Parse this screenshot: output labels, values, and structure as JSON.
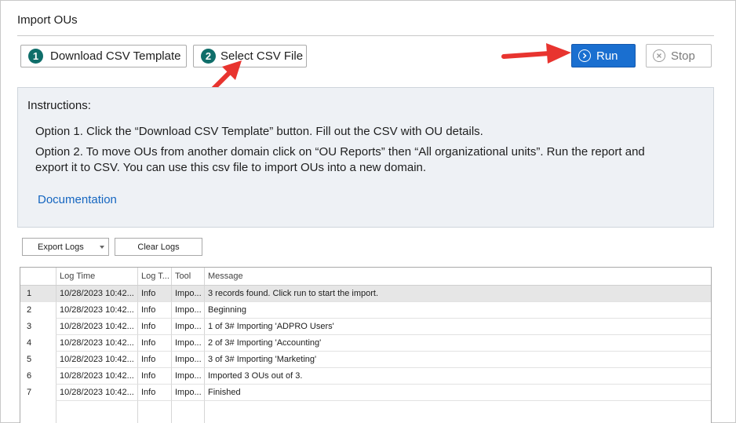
{
  "window": {
    "title": "Import OUs"
  },
  "toolbar": {
    "download": {
      "step": "1",
      "label": "Download CSV Template"
    },
    "select": {
      "step": "2",
      "label": "Select CSV File"
    },
    "run_label": "Run",
    "stop_label": "Stop"
  },
  "instructions": {
    "heading": "Instructions:",
    "option1": "Option 1. Click the “Download CSV Template” button. Fill out the CSV with OU details.",
    "option2_line1": "Option 2. To move OUs from another domain click on “OU Reports” then “All organizational units”. Run the report and",
    "option2_line2": "export it to CSV. You can use this csv file to import OUs into a new domain.",
    "link": "Documentation"
  },
  "log_actions": {
    "export_label": "Export Logs",
    "clear_label": "Clear Logs"
  },
  "log_grid": {
    "columns": [
      "Log Time",
      "Log T...",
      "Tool",
      "Message"
    ],
    "rows": [
      {
        "n": "1",
        "time": "10/28/2023 10:42...",
        "type": "Info",
        "tool": "Impo...",
        "message": "3 records found. Click run to start the import."
      },
      {
        "n": "2",
        "time": "10/28/2023 10:42...",
        "type": "Info",
        "tool": "Impo...",
        "message": "Beginning"
      },
      {
        "n": "3",
        "time": "10/28/2023 10:42...",
        "type": "Info",
        "tool": "Impo...",
        "message": "1 of 3# Importing 'ADPRO Users'"
      },
      {
        "n": "4",
        "time": "10/28/2023 10:42...",
        "type": "Info",
        "tool": "Impo...",
        "message": "2 of 3# Importing 'Accounting'"
      },
      {
        "n": "5",
        "time": "10/28/2023 10:42...",
        "type": "Info",
        "tool": "Impo...",
        "message": "3 of 3# Importing 'Marketing'"
      },
      {
        "n": "6",
        "time": "10/28/2023 10:42...",
        "type": "Info",
        "tool": "Impo...",
        "message": "Imported 3 OUs out of 3."
      },
      {
        "n": "7",
        "time": "10/28/2023 10:42...",
        "type": "Info",
        "tool": "Impo...",
        "message": "Finished"
      }
    ]
  },
  "colors": {
    "accent_run": "#1a6fd0",
    "step_badge": "#0f6e6a",
    "annotation_arrow": "#e8342f",
    "link": "#1566c0"
  }
}
